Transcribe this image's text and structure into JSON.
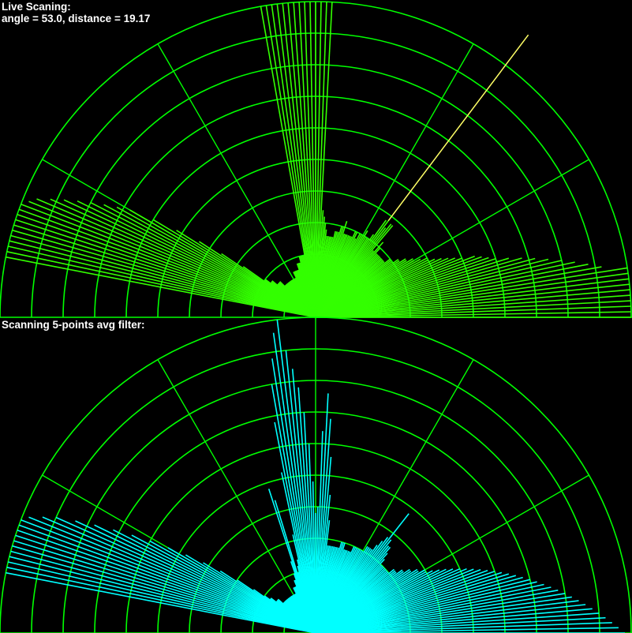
{
  "live_panel": {
    "title": "Live Scaning:",
    "reading_text": "angle = 53.0, distance = 19.17",
    "current_angle_deg": 53.0,
    "current_distance": 19.17
  },
  "filter_panel": {
    "title": "Scanning 5-points avg filter:"
  },
  "colors": {
    "background": "#000000",
    "grid": "#00ff00",
    "live_scan": "#33ff00",
    "sweep_line": "#ffff66",
    "filtered_scan": "#00ffff",
    "text": "#ffffff"
  },
  "scan": {
    "angle_step_deg": 1,
    "rings": 10,
    "spokes_deg": [
      30,
      60,
      90,
      120,
      150
    ],
    "max_range": 50,
    "live_distances": [
      50,
      50,
      50,
      50,
      50,
      50,
      50,
      50,
      50,
      50,
      46,
      44,
      42,
      40,
      38,
      36,
      34,
      32,
      30,
      29,
      28,
      27,
      25,
      24,
      23,
      22,
      21,
      20,
      20,
      19,
      18,
      18,
      17,
      17,
      16,
      16,
      15,
      15,
      15,
      14,
      14,
      14,
      14,
      14,
      14,
      14,
      14,
      15,
      16,
      14,
      19,
      19,
      18,
      19.17,
      19,
      16,
      15,
      15,
      15,
      16,
      15,
      15,
      15,
      14,
      15,
      15,
      14,
      14,
      14,
      14,
      14,
      14,
      16,
      15,
      15,
      14,
      14,
      14,
      13,
      13,
      13,
      13,
      13,
      14,
      15,
      16,
      17,
      50,
      50,
      50,
      50,
      50,
      50,
      50,
      50,
      50,
      50,
      50,
      50,
      50,
      50,
      10,
      10,
      10,
      10,
      10,
      9,
      9,
      9,
      9,
      8,
      8,
      8,
      8,
      8,
      8,
      8,
      7,
      7,
      7,
      7,
      7,
      7,
      7,
      7,
      7,
      7,
      7,
      7,
      7,
      7,
      7,
      7,
      7,
      7,
      8,
      8,
      8,
      8,
      8,
      9,
      9,
      9,
      10,
      10,
      14,
      18,
      22,
      26,
      30,
      34,
      36,
      38,
      40,
      42,
      44,
      46,
      48,
      49,
      50,
      50,
      50,
      50,
      50,
      50,
      50,
      50,
      50,
      50,
      50
    ],
    "filtered_distances": [
      49,
      48,
      47,
      46,
      45,
      44,
      43,
      42,
      41,
      40,
      39,
      38,
      37,
      36,
      35,
      34,
      33,
      32,
      31,
      30,
      29,
      28,
      27,
      26,
      25,
      24,
      23,
      22,
      21,
      20,
      20,
      19,
      19,
      18,
      18,
      17,
      17,
      16,
      16,
      16,
      15,
      15,
      15,
      15,
      15,
      15,
      15,
      16,
      17,
      18,
      18,
      19,
      24,
      19,
      18,
      17,
      16,
      16,
      16,
      16,
      15,
      15,
      15,
      15,
      15,
      15,
      15,
      14,
      14,
      14,
      14,
      14,
      15,
      15,
      15,
      14,
      14,
      14,
      14,
      14,
      14,
      14,
      14,
      18,
      22,
      28,
      34,
      38,
      32,
      20,
      19,
      24,
      30,
      35,
      39,
      42,
      45,
      50,
      48,
      44,
      40,
      34,
      26,
      16,
      12,
      11,
      10,
      22,
      24,
      12,
      10,
      9,
      9,
      8,
      8,
      8,
      8,
      7,
      7,
      7,
      7,
      7,
      7,
      7,
      7,
      7,
      7,
      7,
      7,
      7,
      7,
      7,
      7,
      7,
      7,
      7,
      7,
      7,
      8,
      8,
      8,
      8,
      9,
      9,
      10,
      12,
      15,
      18,
      21,
      24,
      27,
      30,
      33,
      36,
      39,
      42,
      45,
      47,
      49,
      50,
      50,
      50,
      50,
      50,
      50,
      50,
      50,
      50,
      50,
      50
    ]
  }
}
